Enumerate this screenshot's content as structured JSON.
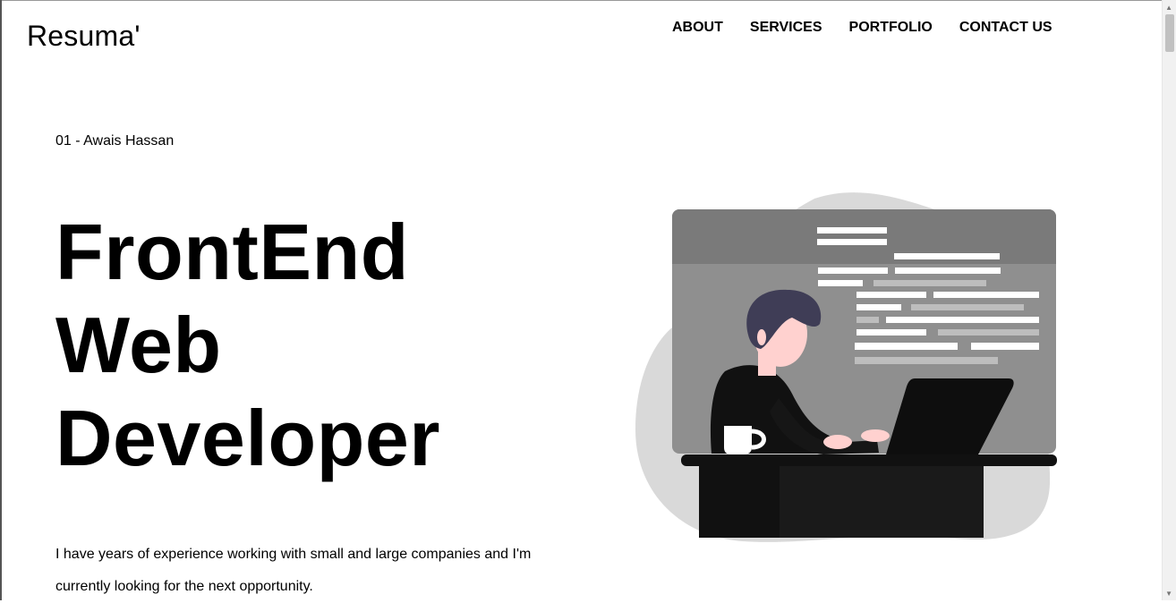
{
  "header": {
    "logo": "Resuma'",
    "nav": [
      "ABOUT",
      "SERVICES",
      "PORTFOLIO",
      "CONTACT US"
    ]
  },
  "hero": {
    "subtitle": "01 - Awais Hassan",
    "headline_lines": [
      "FrontEnd",
      "Web",
      "Developer"
    ],
    "bio": "I have years of experience working with small and large companies and I'm currently looking for the next opportunity."
  },
  "illustration": {
    "description_icon": "developer-at-desk-icon"
  },
  "colors": {
    "background": "#ffffff",
    "text": "#000000",
    "blob": "#d9d9d9",
    "screen": "#8c8c8c",
    "screen_top": "#7a7a7a",
    "skin": "#ffd1cf",
    "hair": "#3f3d56",
    "dark": "#111111"
  }
}
